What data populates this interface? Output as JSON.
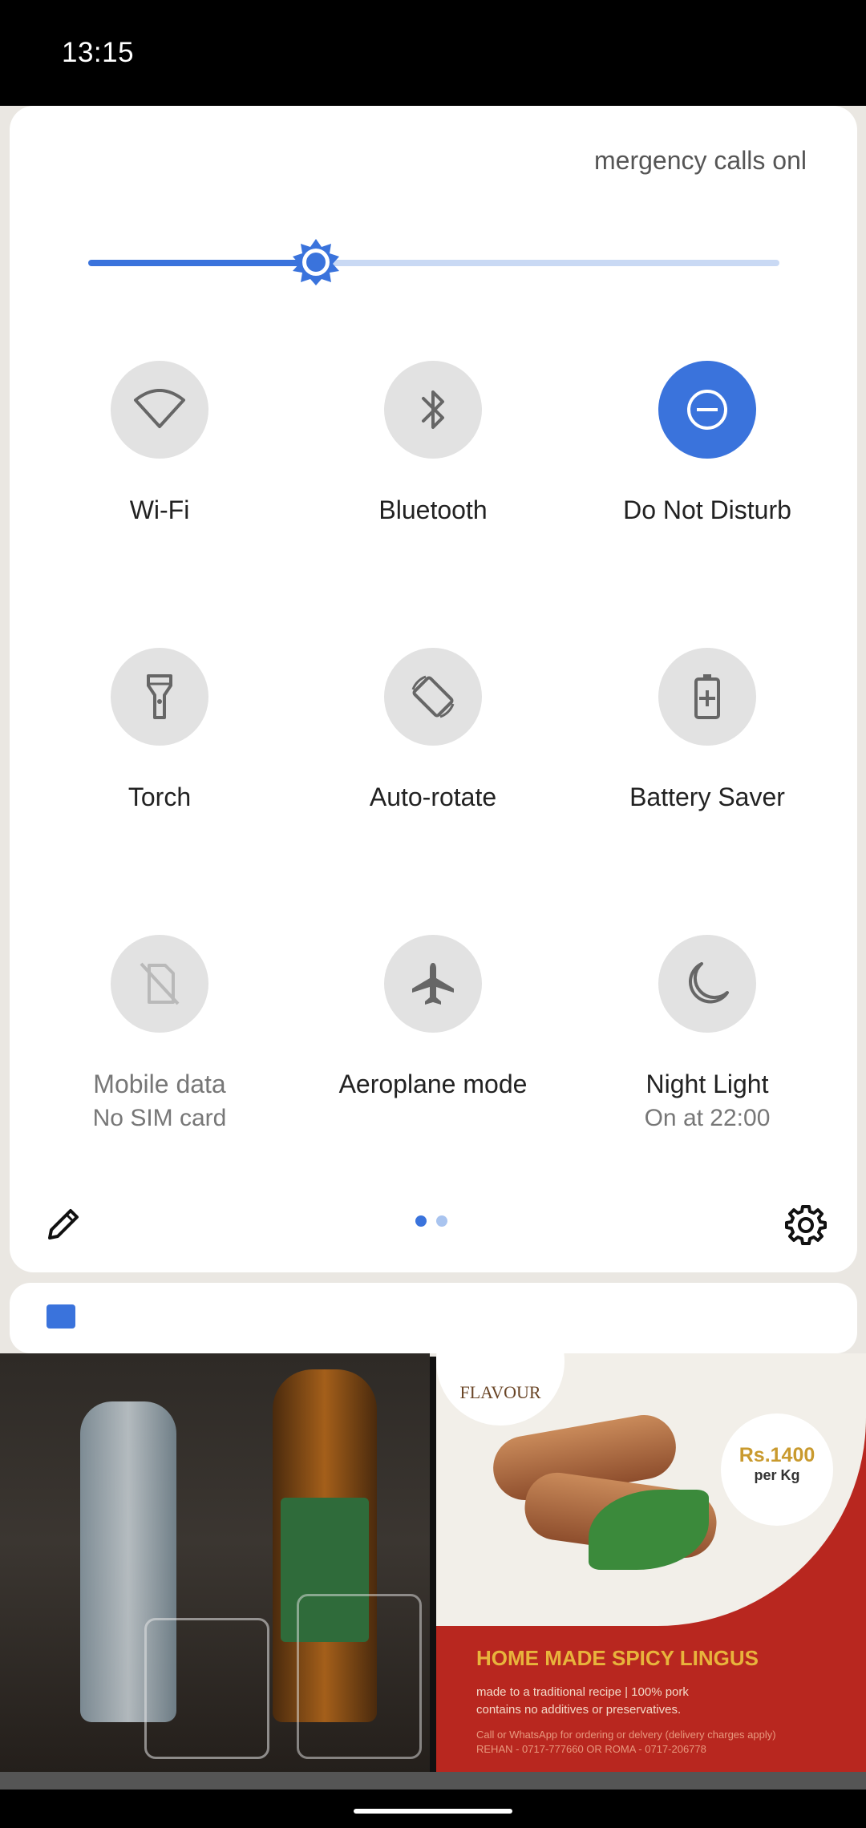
{
  "status_bar": {
    "time": "13:15"
  },
  "quick_settings": {
    "carrier_text": "mergency calls onl",
    "brightness": {
      "level": 0.22
    },
    "tiles": [
      {
        "id": "wifi",
        "label": "Wi-Fi",
        "icon": "wifi-icon",
        "active": false
      },
      {
        "id": "bluetooth",
        "label": "Bluetooth",
        "icon": "bluetooth-icon",
        "active": false
      },
      {
        "id": "dnd",
        "label": "Do Not Disturb",
        "icon": "do-not-disturb-icon",
        "active": true
      },
      {
        "id": "torch",
        "label": "Torch",
        "icon": "torch-icon",
        "active": false
      },
      {
        "id": "autorotate",
        "label": "Auto-rotate",
        "icon": "auto-rotate-icon",
        "active": false
      },
      {
        "id": "battery_saver",
        "label": "Battery Saver",
        "icon": "battery-saver-icon",
        "active": false
      },
      {
        "id": "mobile_data",
        "label": "Mobile data",
        "sublabel": "No SIM card",
        "icon": "mobile-data-off-icon",
        "active": false
      },
      {
        "id": "aeroplane",
        "label": "Aeroplane mode",
        "icon": "aeroplane-icon",
        "active": false
      },
      {
        "id": "night_light",
        "label": "Night Light",
        "sublabel": "On at 22:00",
        "icon": "night-light-icon",
        "active": false
      }
    ],
    "page_indicator": {
      "current": 1,
      "total": 2
    }
  },
  "background_app": {
    "promo": {
      "logo_text": "FLAVOUR",
      "price": "Rs.1400",
      "price_unit": "per Kg",
      "title": "HOME MADE SPICY LINGUS",
      "line1": "made to a traditional recipe | 100% pork",
      "line2": "contains no additives or preservatives.",
      "line3": "Call or WhatsApp for ordering or delvery (delivery charges apply)",
      "line4": "REHAN - 0717-777660 OR ROMA - 0717-206778"
    }
  },
  "colors": {
    "accent": "#3a73dc",
    "tile_inactive": "#e2e2e2"
  }
}
